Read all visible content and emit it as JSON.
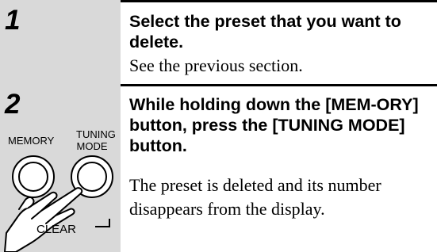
{
  "steps": [
    {
      "number": "1",
      "heading": "Select the preset that you want to delete.",
      "body": "See the previous section."
    },
    {
      "number": "2",
      "heading": "While holding down the [MEM-ORY] button, press the [TUNING MODE] button.",
      "body": "The preset is deleted and its number disappears from the display."
    }
  ],
  "illustration": {
    "memory_label": "MEMORY",
    "tuning_label_line1": "TUNING",
    "tuning_label_line2": "MODE",
    "clear_label": "CLEAR",
    "icons": [
      "memory-button-icon",
      "tuning-mode-button-icon",
      "hand-icon"
    ]
  },
  "colors": {
    "step_column_bg": "#d9d9d9",
    "rule": "#000000",
    "text": "#000000"
  }
}
